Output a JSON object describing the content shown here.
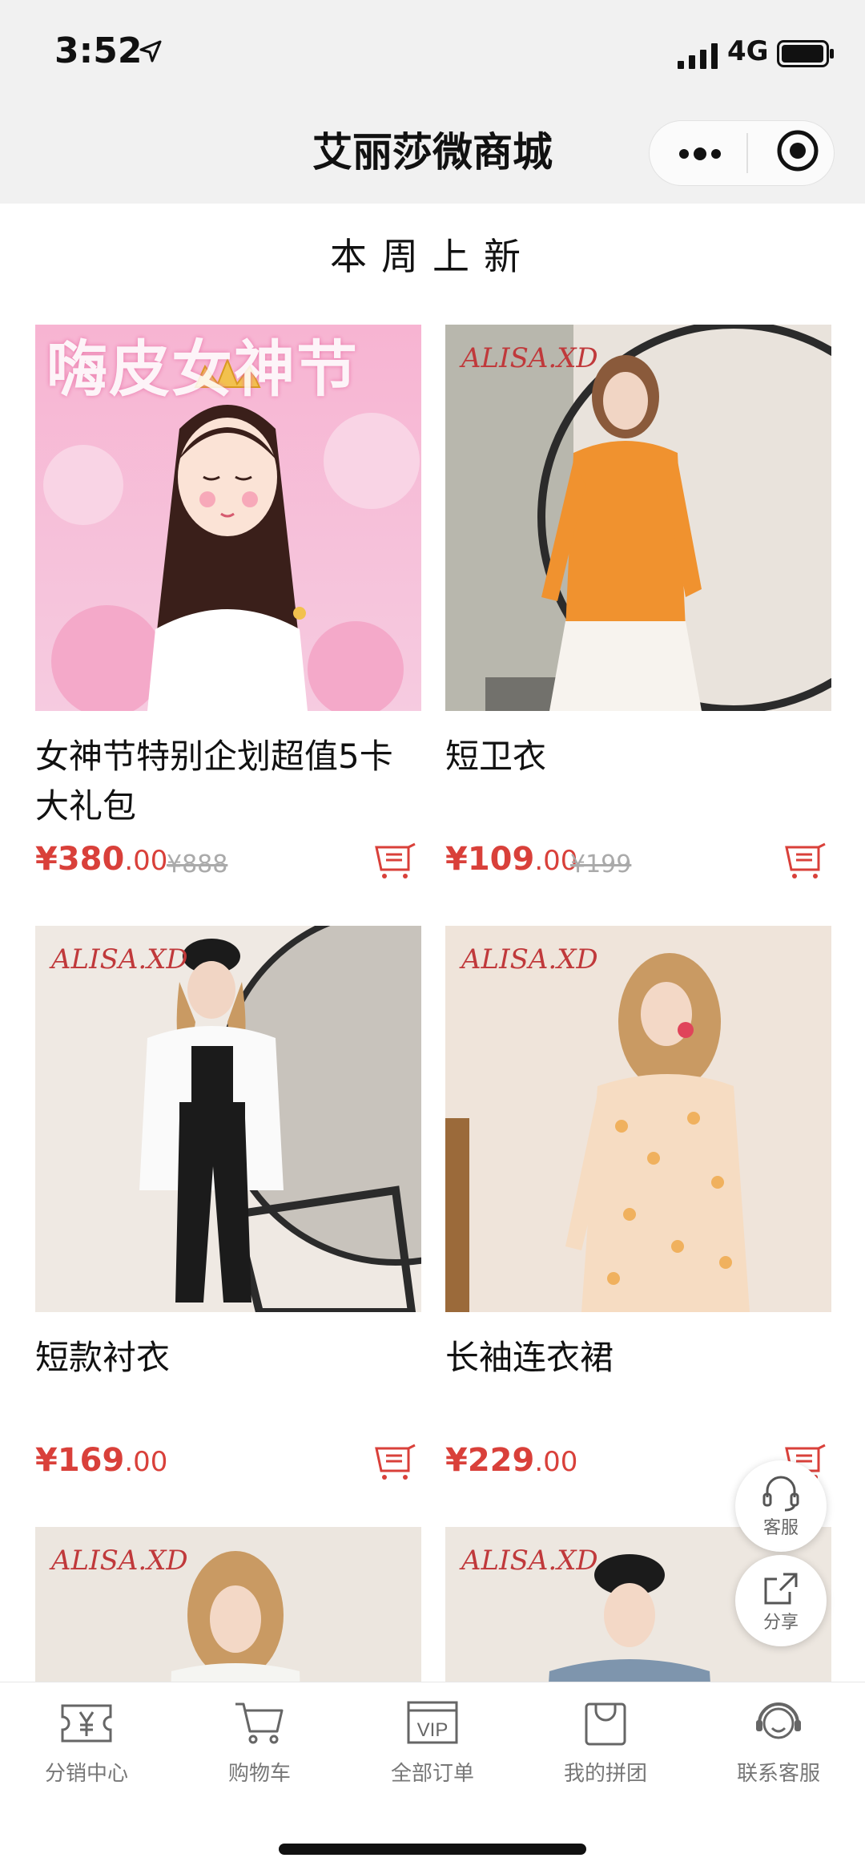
{
  "status": {
    "time": "3:52",
    "network": "4G"
  },
  "nav": {
    "title": "艾丽莎微商城"
  },
  "section": {
    "title": "本周上新"
  },
  "products": [
    {
      "name": "女神节特别企划超值5卡大礼包",
      "price_int": "¥380",
      "price_dec": ".00",
      "original": "¥888",
      "banner_text": "嗨皮女神节"
    },
    {
      "name": "短卫衣",
      "price_int": "¥109",
      "price_dec": ".00",
      "original": "¥199",
      "brand": "ALISA.XD"
    },
    {
      "name": "短款衬衣",
      "price_int": "¥169",
      "price_dec": ".00",
      "original": "",
      "brand": "ALISA.XD"
    },
    {
      "name": "长袖连衣裙",
      "price_int": "¥229",
      "price_dec": ".00",
      "original": "",
      "brand": "ALISA.XD"
    },
    {
      "brand": "ALISA.XD"
    },
    {
      "brand": "ALISA.XD"
    }
  ],
  "floating": {
    "service": "客服",
    "share": "分享"
  },
  "tabs": [
    {
      "label": "分销中心",
      "icon": "ticket-yen-icon"
    },
    {
      "label": "购物车",
      "icon": "cart-icon"
    },
    {
      "label": "全部订单",
      "icon": "vip-icon"
    },
    {
      "label": "我的拼团",
      "icon": "shopping-bag-icon"
    },
    {
      "label": "联系客服",
      "icon": "headset-icon"
    }
  ],
  "colors": {
    "price": "#d9403a",
    "nav_bg": "#f1f1f1"
  }
}
